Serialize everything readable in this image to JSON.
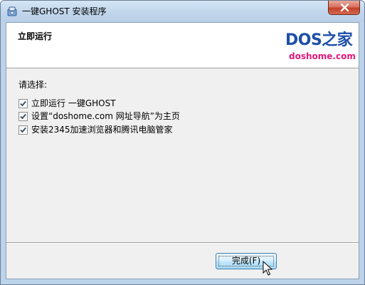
{
  "window": {
    "title": "一键GHOST 安装程序"
  },
  "header": {
    "title": "立即运行",
    "logo_main": "DOS之家",
    "logo_sub": "doshome.com"
  },
  "content": {
    "prompt": "请选择:",
    "options": [
      {
        "label": "立即运行 一键GHOST",
        "checked": true
      },
      {
        "label": "设置“doshome.com 网址导航”为主页",
        "checked": true
      },
      {
        "label": "安装2345加速浏览器和腾讯电脑管家",
        "checked": true
      }
    ]
  },
  "footer": {
    "finish_label": "完成(F)"
  },
  "icons": {
    "app": "installer-icon",
    "close": "close-icon",
    "check": "checkmark-icon",
    "cursor": "mouse-pointer-icon"
  },
  "colors": {
    "logo_blue": "#1d4fa8",
    "logo_pink": "#e0197a",
    "close_red": "#c2402a",
    "button_blue": "#bee6fd"
  }
}
